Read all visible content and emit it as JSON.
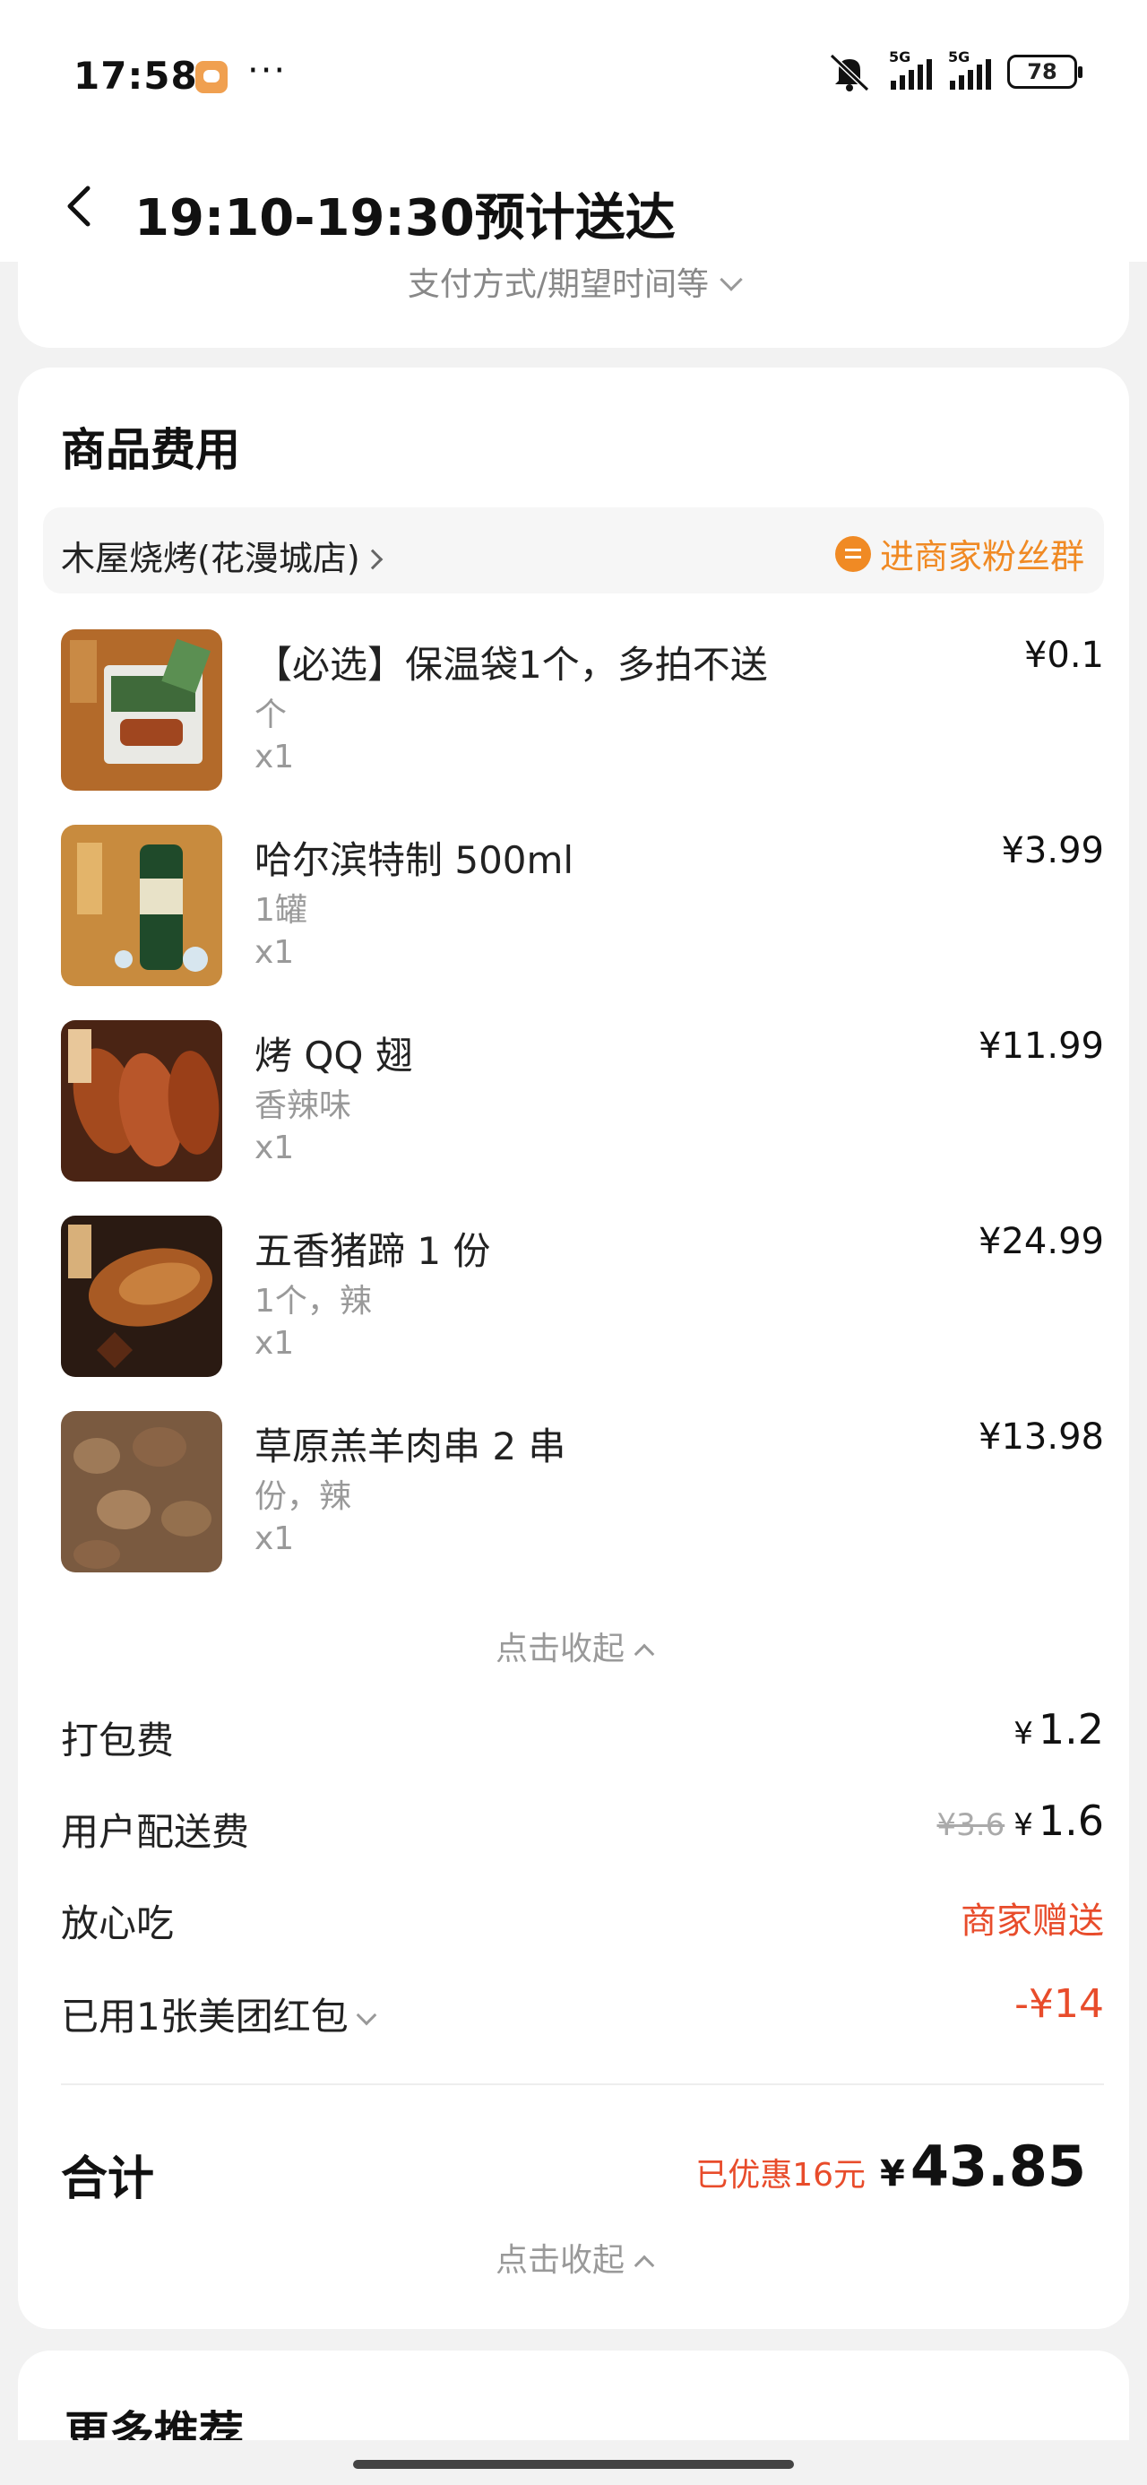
{
  "status_bar": {
    "time": "17:58",
    "dots": "···",
    "signal1": "5G",
    "signal2": "5G",
    "battery": "78"
  },
  "header": {
    "title": "19:10-19:30预计送达"
  },
  "top_card": {
    "toggle_label": "支付方式/期望时间等"
  },
  "fees": {
    "section_title": "商品费用",
    "store_name": "木屋烧烤(花漫城店)",
    "fans_group": "进商家粉丝群",
    "items": [
      {
        "name": "【必选】保温袋1个，多拍不送",
        "spec": "个",
        "qty": "x1",
        "price": "¥0.1"
      },
      {
        "name": "哈尔滨特制 500ml",
        "spec": "1罐",
        "qty": "x1",
        "price": "¥3.99"
      },
      {
        "name": "烤 QQ 翅",
        "spec": "香辣味",
        "qty": "x1",
        "price": "¥11.99"
      },
      {
        "name": "五香猪蹄 1 份",
        "spec": "1个，辣",
        "qty": "x1",
        "price": "¥24.99"
      },
      {
        "name": "草原羔羊肉串 2 串",
        "spec": "份，辣",
        "qty": "x1",
        "price": "¥13.98"
      }
    ],
    "collapse_items": "点击收起",
    "packing_label": "打包费",
    "packing_yen": "¥",
    "packing_value": "1.2",
    "delivery_label": "用户配送费",
    "delivery_original": "¥3.6",
    "delivery_yen": "¥",
    "delivery_value": "1.6",
    "safe_label": "放心吃",
    "safe_value": "商家赠送",
    "coupon_label": "已用1张美团红包",
    "coupon_value": "-¥14",
    "total_label": "合计",
    "total_discount": "已优惠16元",
    "total_yen": "¥",
    "total_value": "43.85",
    "collapse_all": "点击收起"
  },
  "more": {
    "title": "更多推荐"
  },
  "colors": {
    "accent_orange": "#f08a24",
    "discount_red": "#e84c2b"
  }
}
